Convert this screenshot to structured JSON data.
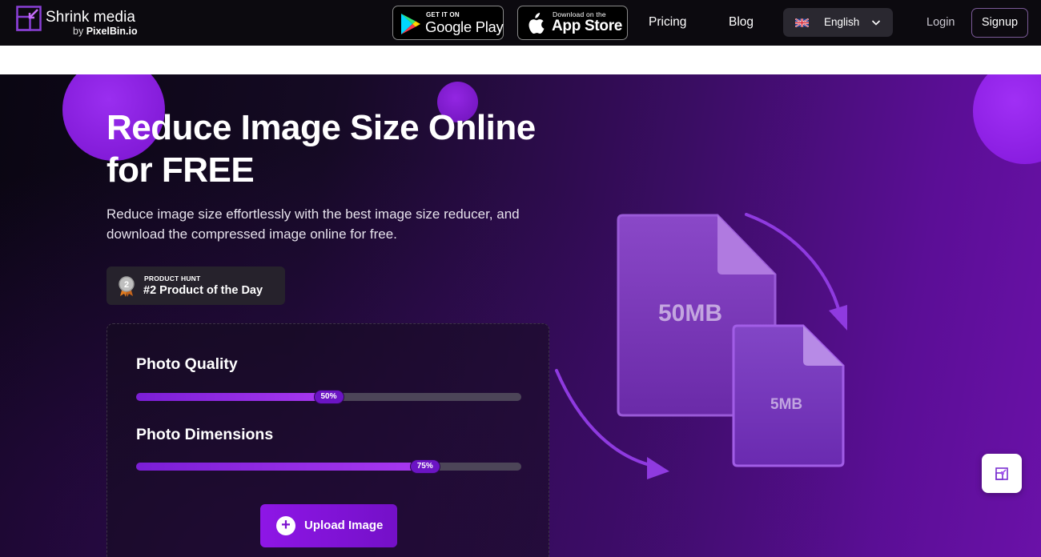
{
  "brand": {
    "name": "Shrink media",
    "by_prefix": "by ",
    "by_name": "PixelBin.io",
    "accent": "#8e16e6"
  },
  "nav": {
    "google_play": {
      "small": "GET IT ON",
      "big": "Google Play"
    },
    "app_store": {
      "small": "Download on the",
      "big": "App Store"
    },
    "pricing": "Pricing",
    "blog": "Blog",
    "language": {
      "flag_icon": "uk-flag-icon",
      "selected": "English"
    },
    "login": "Login",
    "signup": "Signup"
  },
  "hero": {
    "title_line1": "Reduce Image Size Online",
    "title_line2": "for FREE",
    "description": "Reduce image size effortlessly with the best image size reducer, and download the compressed image online for free.",
    "product_hunt": {
      "medal_number": "2",
      "small": "PRODUCT HUNT",
      "big": "#2 Product of the Day"
    }
  },
  "compressor": {
    "quality": {
      "label": "Photo Quality",
      "value": 50,
      "value_text": "50%"
    },
    "dimensions": {
      "label": "Photo Dimensions",
      "value": 75,
      "value_text": "75%"
    },
    "upload_label": "Upload Image"
  },
  "illustration": {
    "large_file_label": "50MB",
    "small_file_label": "5MB"
  }
}
